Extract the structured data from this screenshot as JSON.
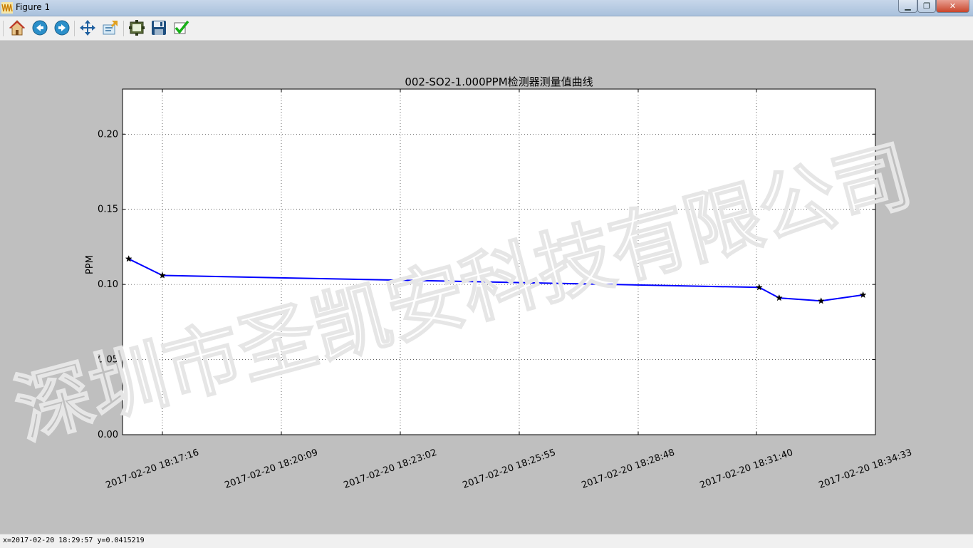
{
  "window": {
    "title": "Figure 1",
    "controls": {
      "minimize": "▁",
      "maximize": "❐",
      "close": "✕"
    }
  },
  "toolbar": {
    "buttons": [
      {
        "name": "home",
        "icon": "home-icon"
      },
      {
        "name": "back",
        "icon": "back-arrow-icon"
      },
      {
        "name": "forward",
        "icon": "forward-arrow-icon"
      },
      {
        "name": "pan",
        "icon": "move-icon"
      },
      {
        "name": "zoom",
        "icon": "zoom-rect-icon"
      },
      {
        "name": "subplots",
        "icon": "configure-subplots-icon"
      },
      {
        "name": "save",
        "icon": "save-icon"
      },
      {
        "name": "edit",
        "icon": "checkmark-icon"
      }
    ]
  },
  "watermark": "深圳市圣凯安科技有限公司",
  "status": {
    "coords": "x=2017-02-20 18:29:57 y=0.0415219"
  },
  "colors": {
    "line": "#0000ff",
    "marker": "#000000",
    "figure_bg": "#bfbfbf",
    "axes_bg": "#ffffff"
  },
  "chart_data": {
    "type": "line",
    "title": "002-SO2-1.000PPM检测器测量值曲线",
    "xlabel": "",
    "ylabel": "PPM",
    "xlim": [
      "2017-02-20 18:16:18",
      "2017-02-20 18:34:33"
    ],
    "ylim": [
      0.0,
      0.23
    ],
    "x_ticks": [
      "2017-02-20 18:17:16",
      "2017-02-20 18:20:09",
      "2017-02-20 18:23:02",
      "2017-02-20 18:25:55",
      "2017-02-20 18:28:48",
      "2017-02-20 18:31:40",
      "2017-02-20 18:34:33"
    ],
    "y_ticks": [
      0.0,
      0.05,
      0.1,
      0.15,
      0.2
    ],
    "y_tick_labels": [
      "0.00",
      "0.05",
      "0.10",
      "0.15",
      "0.20"
    ],
    "grid": true,
    "series": [
      {
        "marker": "star",
        "x": [
          "2017-02-20 18:16:27",
          "2017-02-20 18:17:16",
          "2017-02-20 18:31:44",
          "2017-02-20 18:32:13",
          "2017-02-20 18:33:14",
          "2017-02-20 18:34:15"
        ],
        "y": [
          0.117,
          0.106,
          0.098,
          0.091,
          0.089,
          0.093
        ]
      }
    ]
  }
}
